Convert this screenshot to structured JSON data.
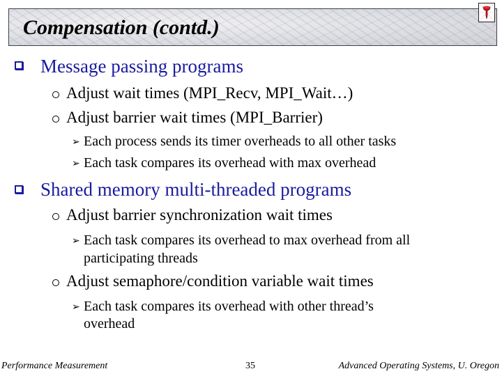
{
  "slide": {
    "title": "Compensation (contd.)",
    "corner_icon": "pushpin-icon",
    "bullets": [
      {
        "text": "Message passing programs",
        "icon": "square-bullet-icon",
        "children": [
          {
            "text": "Adjust wait times (MPI_Recv, MPI_Wait…)",
            "icon": "circle-bullet-icon"
          },
          {
            "text": "Adjust barrier wait times (MPI_Barrier)",
            "icon": "circle-bullet-icon",
            "children": [
              {
                "text": "Each process sends its timer overheads to all other tasks",
                "icon": "arrow-bullet-icon"
              },
              {
                "text": "Each task compares its overhead with max overhead",
                "icon": "arrow-bullet-icon"
              }
            ]
          }
        ]
      },
      {
        "text": "Shared memory multi-threaded programs",
        "icon": "square-bullet-icon",
        "children": [
          {
            "text": "Adjust barrier synchronization wait times",
            "icon": "circle-bullet-icon",
            "children": [
              {
                "text_line1": "Each task compares its overhead to max overhead from all",
                "text_line2": "participating threads",
                "icon": "arrow-bullet-icon"
              }
            ]
          },
          {
            "text": "Adjust semaphore/condition variable wait times",
            "icon": "circle-bullet-icon",
            "children": [
              {
                "text_line1": "Each task compares its overhead with other thread’s",
                "text_line2": "overhead",
                "icon": "arrow-bullet-icon"
              }
            ]
          }
        ]
      }
    ]
  },
  "footer": {
    "left": "Performance Measurement",
    "page_number": "35",
    "right": "Advanced Operating Systems, U. Oregon"
  },
  "colors": {
    "level1_text": "#1a1aa0",
    "body_text": "#000000",
    "title_border": "#3a4150"
  }
}
